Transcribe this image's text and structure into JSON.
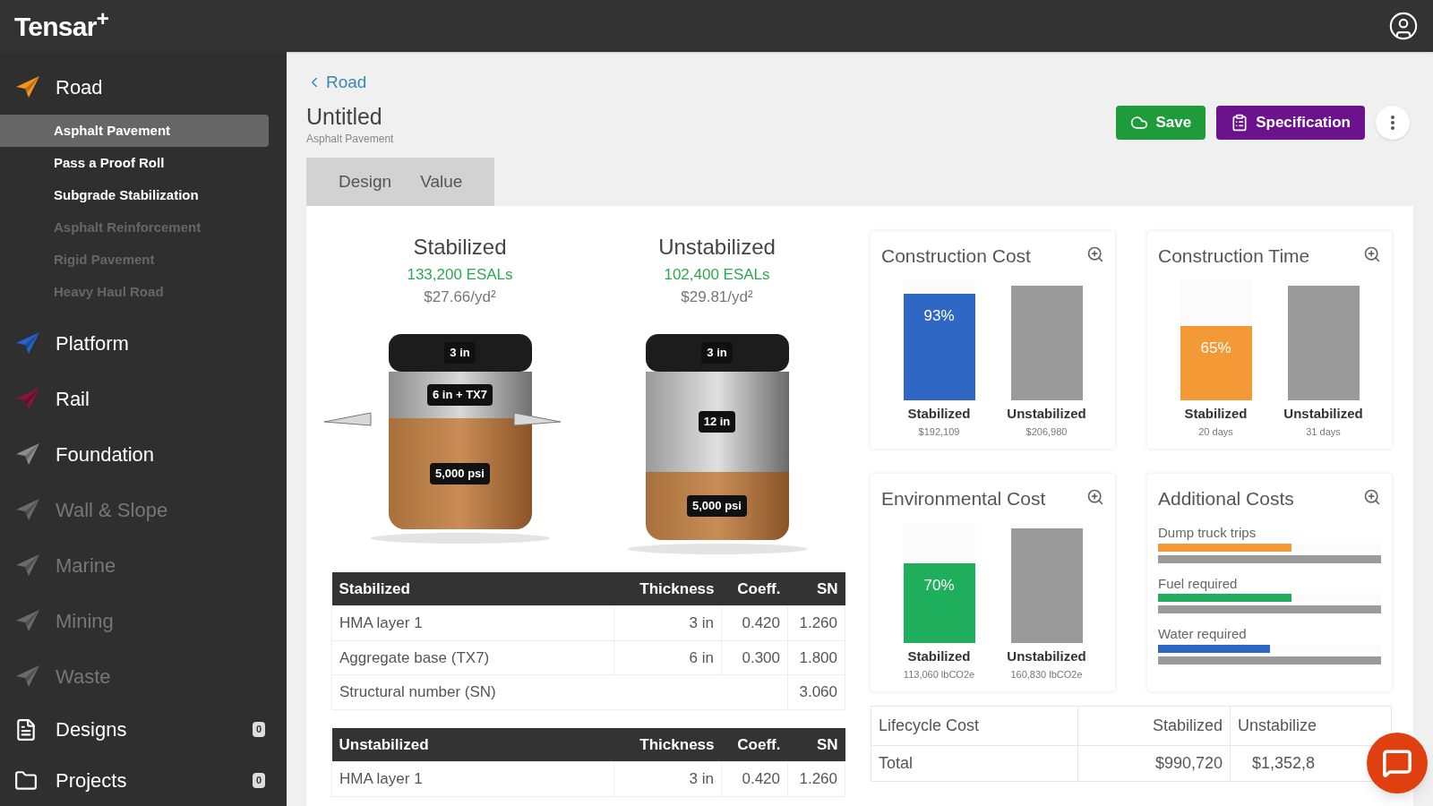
{
  "app": {
    "logo": "Tensar",
    "logo_mark": "+"
  },
  "sidebar": {
    "sections": [
      {
        "label": "Road",
        "color": "#f7941d",
        "enabled": true,
        "children": [
          {
            "label": "Asphalt Pavement",
            "selected": true,
            "disabled": false
          },
          {
            "label": "Pass a Proof Roll",
            "selected": false,
            "disabled": false
          },
          {
            "label": "Subgrade Stabilization",
            "selected": false,
            "disabled": false
          },
          {
            "label": "Asphalt Reinforcement",
            "selected": false,
            "disabled": true
          },
          {
            "label": "Rigid Pavement",
            "selected": false,
            "disabled": true
          },
          {
            "label": "Heavy Haul Road",
            "selected": false,
            "disabled": true
          }
        ]
      },
      {
        "label": "Platform",
        "color": "#2563c9",
        "enabled": true
      },
      {
        "label": "Rail",
        "color": "#8a1538",
        "enabled": true
      },
      {
        "label": "Foundation",
        "color": "#8c8c8c",
        "enabled": true
      },
      {
        "label": "Wall & Slope",
        "color": "#6b6b6b",
        "enabled": false
      },
      {
        "label": "Marine",
        "color": "#6b6b6b",
        "enabled": false
      },
      {
        "label": "Mining",
        "color": "#6b6b6b",
        "enabled": false
      },
      {
        "label": "Waste",
        "color": "#6b6b6b",
        "enabled": false
      }
    ],
    "links": [
      {
        "label": "Designs",
        "badge": "0",
        "kind": "document"
      },
      {
        "label": "Projects",
        "badge": "0",
        "kind": "folder"
      }
    ]
  },
  "breadcrumb": "Road",
  "title": "Untitled",
  "subtitle": "Asphalt Pavement",
  "actions": [
    {
      "label": "Save",
      "kind": "save"
    },
    {
      "label": "Specification",
      "kind": "spec"
    }
  ],
  "tabs": [
    {
      "label": "Design"
    },
    {
      "label": "Value"
    }
  ],
  "sections": [
    {
      "name": "Stabilized",
      "esals": "133,200 ESALs",
      "price": "$27.66/yd²",
      "geogrid": true,
      "layers": [
        {
          "kind": "asphalt",
          "label": "3 in"
        },
        {
          "kind": "aggregate",
          "label": "6 in + TX7"
        },
        {
          "kind": "subgrade",
          "label": "5,000 psi"
        }
      ]
    },
    {
      "name": "Unstabilized",
      "esals": "102,400 ESALs",
      "price": "$29.81/yd²",
      "geogrid": false,
      "layers": [
        {
          "kind": "asphalt",
          "label": "3 in"
        },
        {
          "kind": "aggregate_thick",
          "label": "12 in"
        },
        {
          "kind": "subgrade_short",
          "label": "5,000 psi"
        }
      ]
    }
  ],
  "tables": [
    {
      "columns": [
        "Stabilized",
        "Thickness",
        "Coeff.",
        "SN"
      ],
      "rows": [
        {
          "kind": "layer",
          "cells": [
            "HMA layer 1",
            "3 in",
            "0.420",
            "1.260"
          ]
        },
        {
          "kind": "layer",
          "cells": [
            "Aggregate base (TX7)",
            "6 in",
            "0.300",
            "1.800"
          ]
        },
        {
          "kind": "total",
          "cells": [
            "Structural number (SN)",
            "",
            "",
            "3.060"
          ]
        }
      ]
    },
    {
      "columns": [
        "Unstabilized",
        "Thickness",
        "Coeff.",
        "SN"
      ],
      "rows": [
        {
          "kind": "layer",
          "cells": [
            "HMA layer 1",
            "3 in",
            "0.420",
            "1.260"
          ]
        }
      ]
    }
  ],
  "cards": [
    {
      "title": "Construction Cost",
      "kind": "bars",
      "bars": [
        {
          "label": "Stabilized",
          "value": "$192,109",
          "percent": "93%",
          "level": 0.93,
          "color": "#2f68c4"
        },
        {
          "label": "Unstabilized",
          "value": "$206,980",
          "level": 1,
          "color": "#9a9a9a"
        }
      ]
    },
    {
      "title": "Construction Time",
      "kind": "bars",
      "bars": [
        {
          "label": "Stabilized",
          "value": "20 days",
          "percent": "65%",
          "level": 0.65,
          "color": "#f39a36"
        },
        {
          "label": "Unstabilized",
          "value": "31 days",
          "level": 1,
          "color": "#9a9a9a"
        }
      ]
    },
    {
      "title": "Environmental Cost",
      "kind": "bars",
      "bars": [
        {
          "label": "Stabilized",
          "value": "113,060 lbCO2e",
          "percent": "70%",
          "level": 0.7,
          "color": "#1fae5b"
        },
        {
          "label": "Unstabilized",
          "value": "160,830 lbCO2e",
          "level": 1,
          "color": "#9a9a9a"
        }
      ]
    },
    {
      "title": "Additional Costs",
      "kind": "meters",
      "meters": [
        {
          "label": "Dump truck trips",
          "level": 0.6,
          "color": "#f39a36"
        },
        {
          "label": "Fuel required",
          "level": 0.6,
          "color": "#1fae5b"
        },
        {
          "label": "Water required",
          "level": 0.5,
          "color": "#2f68c4"
        }
      ]
    }
  ],
  "lifecycle": {
    "columns": [
      "Lifecycle Cost",
      "Stabilized",
      "Unstabilize"
    ],
    "rows": [
      [
        "Total",
        "$990,720",
        "$1,352,8"
      ]
    ]
  }
}
